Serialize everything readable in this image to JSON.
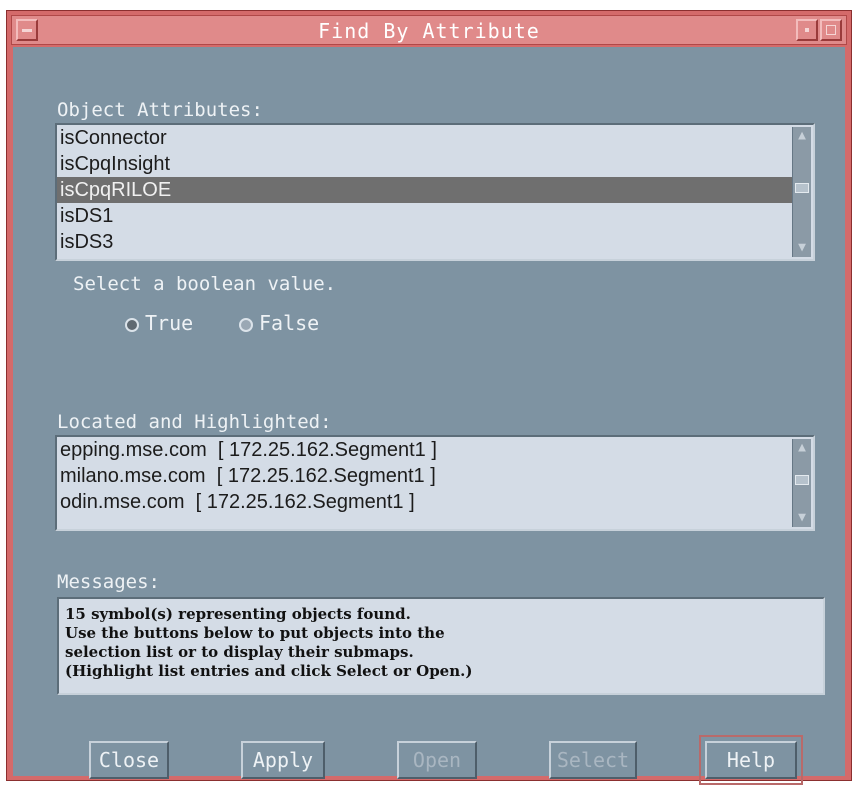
{
  "window": {
    "title": "Find By Attribute"
  },
  "attributes": {
    "label": "Object Attributes:",
    "items": [
      "isConnector",
      "isCpqInsight",
      "isCpqRILOE",
      "isDS1",
      "isDS3"
    ],
    "selected": "isCpqRILOE"
  },
  "boolean": {
    "prompt": "Select a boolean value.",
    "true_label": "True",
    "false_label": "False",
    "value": "True"
  },
  "located": {
    "label": "Located and Highlighted:",
    "items": [
      "epping.mse.com  [ 172.25.162.Segment1 ]",
      "milano.mse.com  [ 172.25.162.Segment1 ]",
      "odin.mse.com  [ 172.25.162.Segment1 ]"
    ]
  },
  "messages": {
    "label": "Messages:",
    "text": "15 symbol(s) representing objects found.\nUse the buttons below to put objects into the\nselection list or to display their submaps.\n(Highlight list entries and click Select or Open.)"
  },
  "buttons": {
    "close": "Close",
    "apply": "Apply",
    "open": "Open",
    "select": "Select",
    "help": "Help"
  },
  "colors": {
    "titlebar": "#e08a8a",
    "client": "#7e93a2",
    "list_bg": "#d4dce6",
    "selection": "#6f6f6f"
  }
}
